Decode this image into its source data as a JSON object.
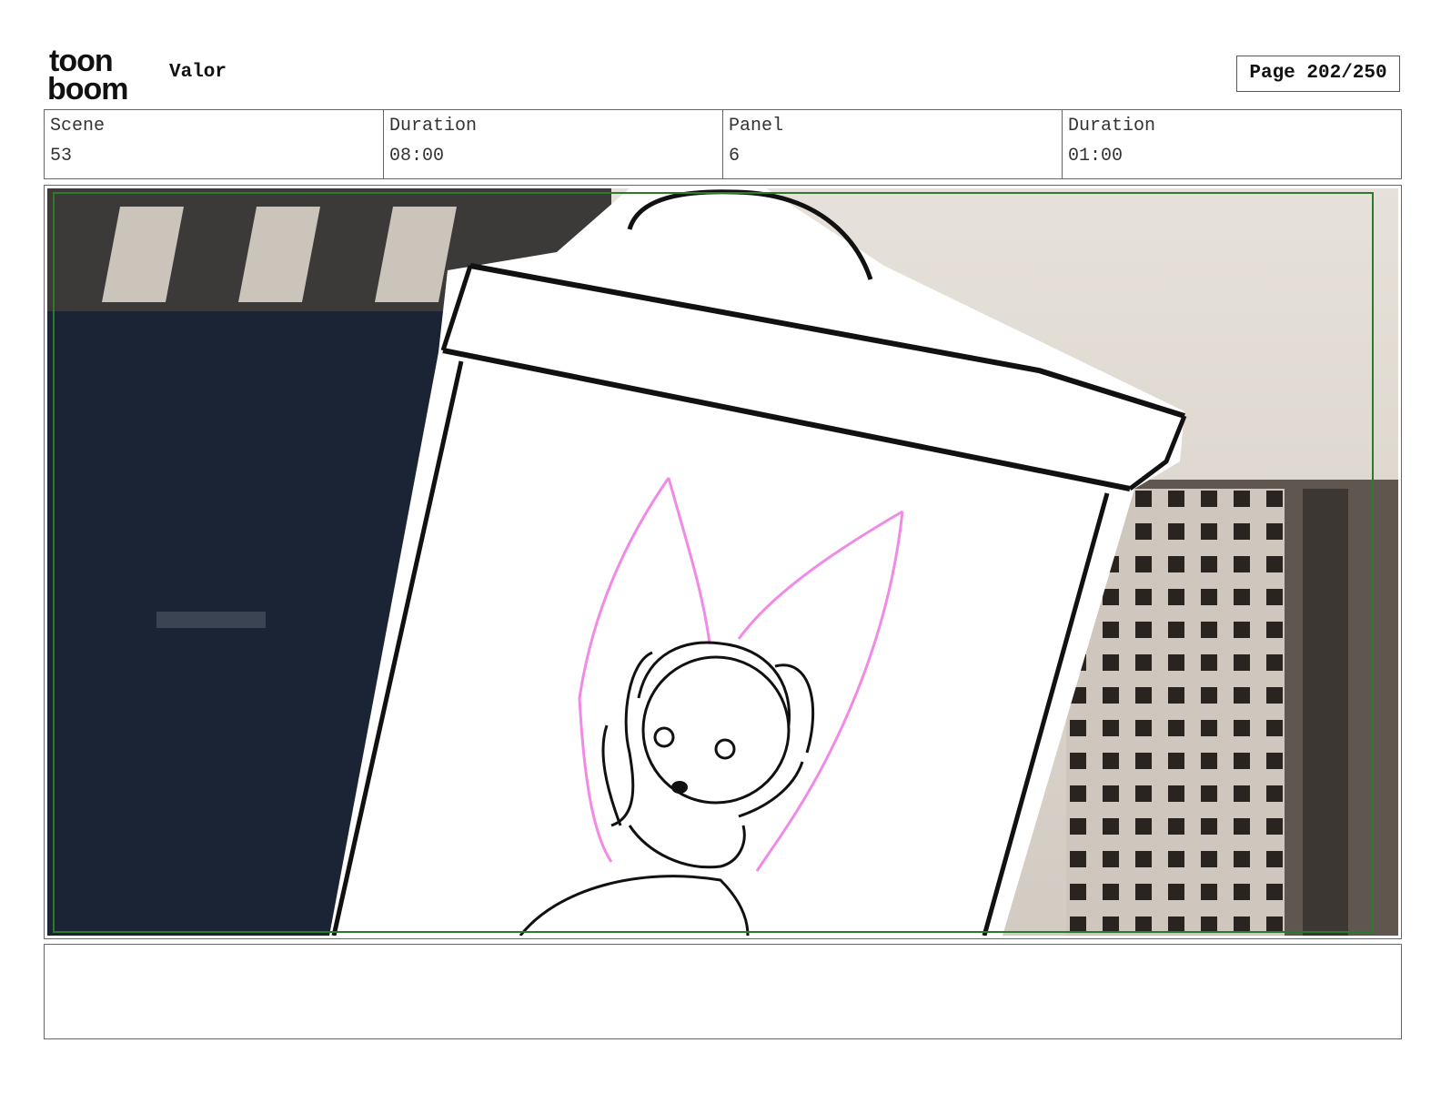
{
  "header": {
    "logo": {
      "name": "toon boom",
      "line1": "toon",
      "line2": "boom"
    },
    "project_title": "Valor",
    "page_label": "Page 202/250"
  },
  "info_table": {
    "scene_label": "Scene",
    "scene_value": "53",
    "scene_duration_label": "Duration",
    "scene_duration_value": "08:00",
    "panel_label": "Panel",
    "panel_value": "6",
    "panel_duration_label": "Duration",
    "panel_duration_value": "01:00"
  },
  "panel": {
    "colors": {
      "dark_wall": "#1b2434",
      "light_ceiling": "#e3ded6",
      "grid_building": "#6e655c",
      "ink": "#111111",
      "pink_sketch": "#f08ae6",
      "frame_green": "#2d7a2d"
    }
  },
  "notes": {
    "text": ""
  }
}
